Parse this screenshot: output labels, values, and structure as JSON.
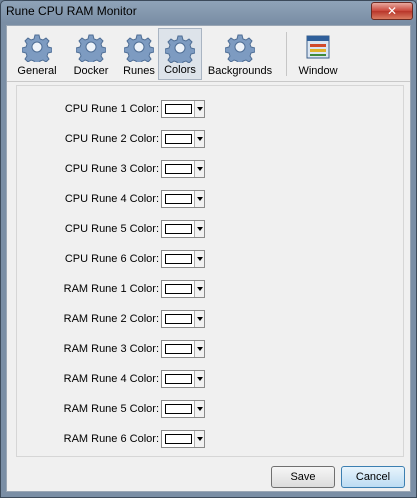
{
  "window": {
    "title": "Rune CPU RAM Monitor",
    "close_glyph": "✕"
  },
  "toolbar": {
    "items": [
      {
        "label": "General",
        "icon": "gear-icon"
      },
      {
        "label": "Docker",
        "icon": "gear-icon"
      },
      {
        "label": "Runes",
        "icon": "gear-icon"
      },
      {
        "label": "Colors",
        "icon": "gear-icon",
        "active": true
      },
      {
        "label": "Backgrounds",
        "icon": "gear-icon"
      },
      {
        "label": "Window",
        "icon": "window-icon"
      }
    ]
  },
  "colors": {
    "rows": [
      {
        "label": "CPU Rune 1 Color:",
        "value": "#ffffff"
      },
      {
        "label": "CPU Rune 2 Color:",
        "value": "#ffffff"
      },
      {
        "label": "CPU Rune 3 Color:",
        "value": "#ffffff"
      },
      {
        "label": "CPU Rune 4 Color:",
        "value": "#ffffff"
      },
      {
        "label": "CPU Rune 5 Color:",
        "value": "#ffffff"
      },
      {
        "label": "CPU Rune 6 Color:",
        "value": "#ffffff"
      },
      {
        "label": "RAM Rune 1 Color:",
        "value": "#ffffff"
      },
      {
        "label": "RAM Rune 2 Color:",
        "value": "#ffffff"
      },
      {
        "label": "RAM Rune 3 Color:",
        "value": "#ffffff"
      },
      {
        "label": "RAM Rune 4 Color:",
        "value": "#ffffff"
      },
      {
        "label": "RAM Rune 5 Color:",
        "value": "#ffffff"
      },
      {
        "label": "RAM Rune 6 Color:",
        "value": "#ffffff"
      }
    ]
  },
  "buttons": {
    "save": "Save",
    "cancel": "Cancel"
  }
}
